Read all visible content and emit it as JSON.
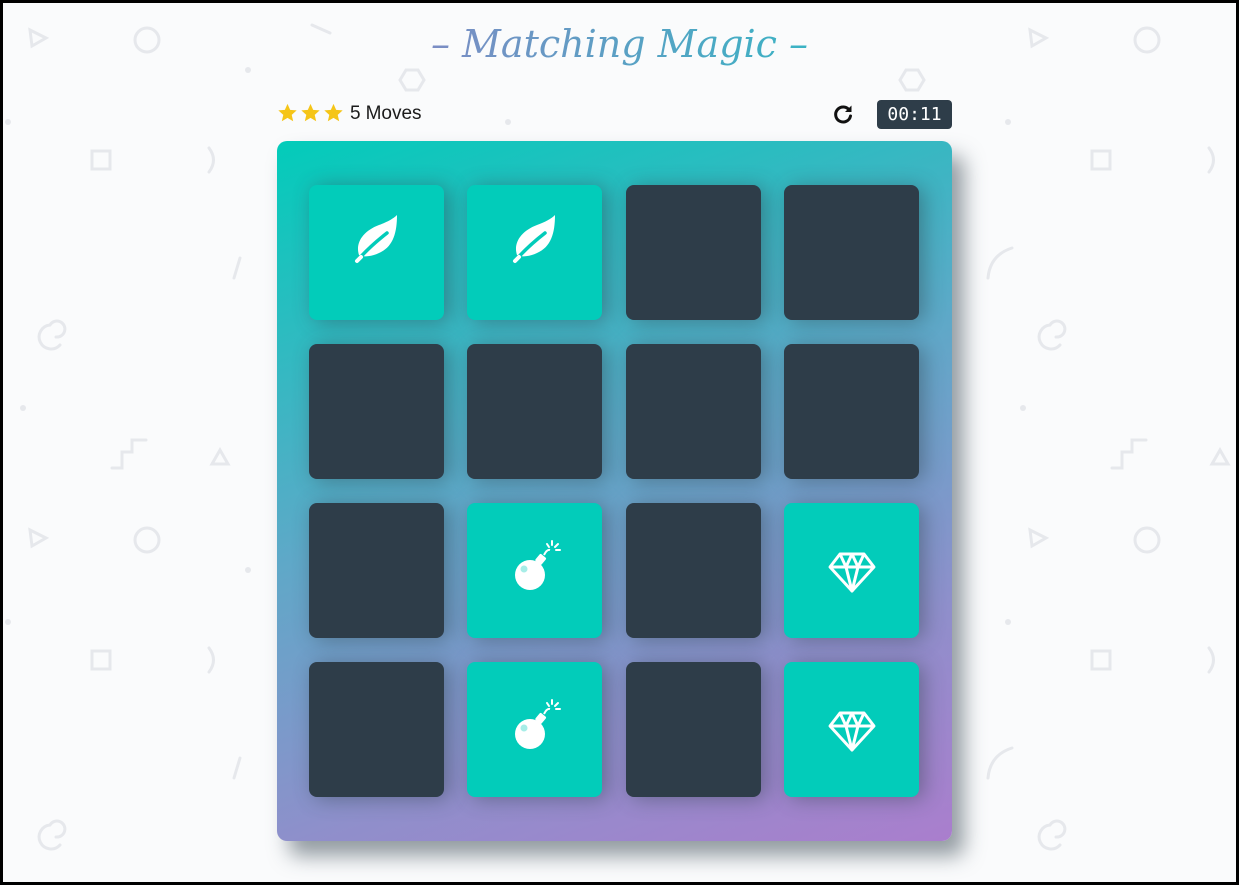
{
  "title": "– Matching Magic –",
  "score_panel": {
    "stars": 3,
    "moves_count": "5",
    "moves_label": "Moves",
    "restart_icon": "redo-icon",
    "timer": "00:11"
  },
  "colors": {
    "card_closed": "#2e3d49",
    "card_open": "#02ccba",
    "star": "#f5c518",
    "timer_bg": "#2e3d49"
  },
  "deck": {
    "cards": [
      {
        "state": "open",
        "icon": "leaf-icon"
      },
      {
        "state": "open",
        "icon": "leaf-icon"
      },
      {
        "state": "closed",
        "icon": ""
      },
      {
        "state": "closed",
        "icon": ""
      },
      {
        "state": "closed",
        "icon": ""
      },
      {
        "state": "closed",
        "icon": ""
      },
      {
        "state": "closed",
        "icon": ""
      },
      {
        "state": "closed",
        "icon": ""
      },
      {
        "state": "closed",
        "icon": ""
      },
      {
        "state": "open",
        "icon": "bomb-icon"
      },
      {
        "state": "closed",
        "icon": ""
      },
      {
        "state": "open",
        "icon": "diamond-icon"
      },
      {
        "state": "closed",
        "icon": ""
      },
      {
        "state": "open",
        "icon": "bomb-icon"
      },
      {
        "state": "closed",
        "icon": ""
      },
      {
        "state": "open",
        "icon": "diamond-icon"
      }
    ]
  }
}
